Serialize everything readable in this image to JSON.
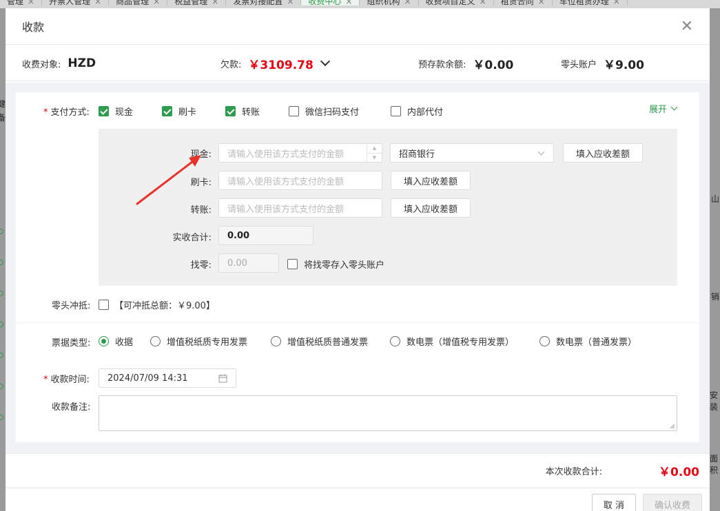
{
  "background": {
    "tabs": [
      {
        "label": "管理",
        "active": false
      },
      {
        "label": "开票人管理",
        "active": false
      },
      {
        "label": "商品管理",
        "active": false
      },
      {
        "label": "税益管理",
        "active": false
      },
      {
        "label": "发票对接配置",
        "active": false
      },
      {
        "label": "收费中心",
        "active": true
      },
      {
        "label": "组织机构",
        "active": false
      },
      {
        "label": "收费项目定义",
        "active": false
      },
      {
        "label": "租赁合同",
        "active": false
      },
      {
        "label": "车位租赁办理",
        "active": false
      }
    ],
    "side_texts": [
      "健",
      "备",
      "山",
      "销",
      "安装",
      "面积"
    ]
  },
  "modal": {
    "title": "收款",
    "close_icon": "close-icon",
    "summary": {
      "target_label": "收费对象:",
      "target_value": "HZD",
      "debt_label": "欠款:",
      "debt_value": "￥3109.78",
      "prepaid_label": "预存款余额:",
      "prepaid_value": "￥0.00",
      "change_account_label": "零头账户",
      "change_account_value": "￥9.00"
    },
    "payment": {
      "label": "支付方式:",
      "expand_label": "展开",
      "methods": [
        {
          "label": "现金",
          "checked": true
        },
        {
          "label": "刷卡",
          "checked": true
        },
        {
          "label": "转账",
          "checked": true
        },
        {
          "label": "微信扫码支付",
          "checked": false
        },
        {
          "label": "内部代付",
          "checked": false
        }
      ],
      "cash_label": "现金:",
      "card_label": "刷卡:",
      "transfer_label": "转账:",
      "amount_placeholder": "请输入使用该方式支付的金额",
      "bank_value": "招商银行",
      "fill_diff_label": "填入应收差额",
      "total_label": "实收合计:",
      "total_value": "0.00",
      "change_label": "找零:",
      "change_value": "0.00",
      "save_change_label": "将找零存入零头账户"
    },
    "offset": {
      "label": "零头冲抵:",
      "available_text": "【可冲抵总额：￥9.00】"
    },
    "receipt_type": {
      "label": "票据类型:",
      "options": [
        {
          "label": "收据",
          "selected": true
        },
        {
          "label": "增值税纸质专用发票",
          "selected": false
        },
        {
          "label": "增值税纸质普通发票",
          "selected": false
        },
        {
          "label": "数电票（增值税专用发票）",
          "selected": false
        },
        {
          "label": "数电票（普通发票）",
          "selected": false
        }
      ]
    },
    "receive_time": {
      "label": "收款时间:",
      "value": "2024/07/09 14:31"
    },
    "remark": {
      "label": "收款备注:"
    },
    "footer": {
      "total_label": "本次收款合计:",
      "total_value": "￥0.00",
      "cancel_label": "取 消",
      "confirm_label": "确认收费"
    },
    "colors": {
      "accent": "#2e9b4e",
      "danger": "#e60012",
      "annotation_arrow": "#e8322b"
    }
  }
}
